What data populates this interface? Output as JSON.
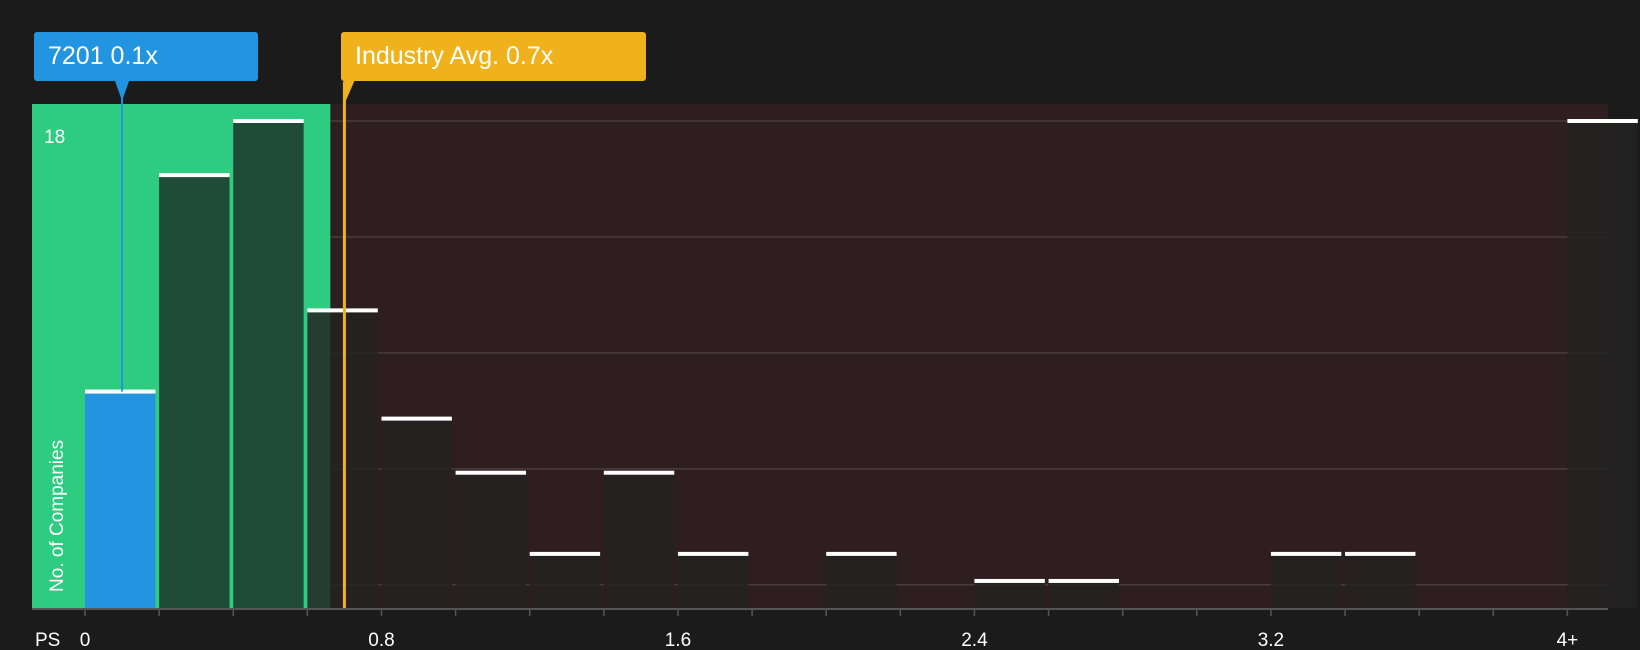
{
  "chart_data": {
    "type": "bar",
    "x_axis_label": "PS",
    "y_axis_label": "No. of Companies",
    "y_max_label": "18",
    "ylim": [
      0,
      18
    ],
    "bins": [
      {
        "start": 0.0,
        "end": 0.2,
        "value": 8
      },
      {
        "start": 0.2,
        "end": 0.4,
        "value": 16
      },
      {
        "start": 0.4,
        "end": 0.6,
        "value": 18
      },
      {
        "start": 0.6,
        "end": 0.8,
        "value": 11
      },
      {
        "start": 0.8,
        "end": 1.0,
        "value": 7
      },
      {
        "start": 1.0,
        "end": 1.2,
        "value": 5
      },
      {
        "start": 1.2,
        "end": 1.4,
        "value": 2
      },
      {
        "start": 1.4,
        "end": 1.6,
        "value": 5
      },
      {
        "start": 1.6,
        "end": 1.8,
        "value": 2
      },
      {
        "start": 1.8,
        "end": 2.0,
        "value": 0
      },
      {
        "start": 2.0,
        "end": 2.2,
        "value": 2
      },
      {
        "start": 2.2,
        "end": 2.4,
        "value": 0
      },
      {
        "start": 2.4,
        "end": 2.6,
        "value": 1
      },
      {
        "start": 2.6,
        "end": 2.8,
        "value": 1
      },
      {
        "start": 2.8,
        "end": 3.0,
        "value": 0
      },
      {
        "start": 3.0,
        "end": 3.2,
        "value": 0
      },
      {
        "start": 3.2,
        "end": 3.4,
        "value": 2
      },
      {
        "start": 3.4,
        "end": 3.6,
        "value": 2
      },
      {
        "start": 3.6,
        "end": 3.8,
        "value": 0
      },
      {
        "start": 3.8,
        "end": 4.0,
        "value": 0
      },
      {
        "start": 4.0,
        "end": 4.2,
        "value": 18
      }
    ],
    "x_ticks": [
      {
        "value": 0,
        "label": "0"
      },
      {
        "value": 0.8,
        "label": "0.8"
      },
      {
        "value": 1.6,
        "label": "1.6"
      },
      {
        "value": 2.4,
        "label": "2.4"
      },
      {
        "value": 3.2,
        "label": "3.2"
      },
      {
        "value": 4.0,
        "label": "4+"
      }
    ],
    "company": {
      "ticker": "7201",
      "value": 0.1,
      "label": "7201 0.1x"
    },
    "industry": {
      "value": 0.7,
      "label": "Industry Avg. 0.7x"
    },
    "colors": {
      "background": "#1b1b1b",
      "undervalued_zone": "#2ecc80",
      "overvalued_zone": "#2e1e1f",
      "company_bar": "#2394e0",
      "industry_line": "#efb21c",
      "bar_fill": "#232222",
      "bar_top": "#ffffff",
      "grid": "#4a3c3c",
      "axis": "#555555"
    }
  }
}
